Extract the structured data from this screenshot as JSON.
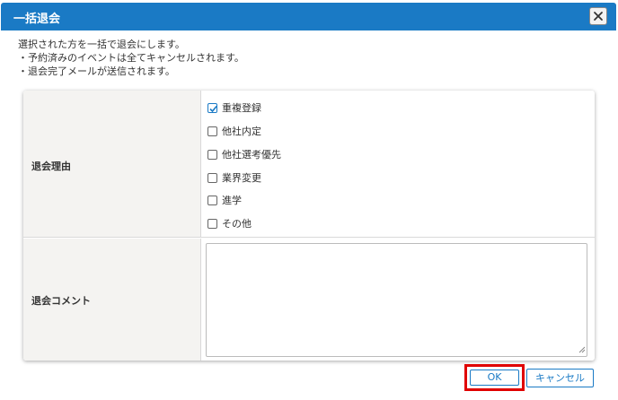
{
  "dialog": {
    "title": "一括退会",
    "close_icon": "close-icon"
  },
  "description": {
    "lines": [
      "選択された方を一括で退会にします。",
      "・予約済みのイベントは全てキャンセルされます。",
      "・退会完了メールが送信されます。"
    ]
  },
  "form": {
    "reason_label": "退会理由",
    "reasons": [
      {
        "label": "重複登録",
        "checked": true
      },
      {
        "label": "他社内定",
        "checked": false
      },
      {
        "label": "他社選考優先",
        "checked": false
      },
      {
        "label": "業界変更",
        "checked": false
      },
      {
        "label": "進学",
        "checked": false
      },
      {
        "label": "その他",
        "checked": false
      }
    ],
    "comment_label": "退会コメント",
    "comment_value": ""
  },
  "buttons": {
    "ok_label": "OK",
    "cancel_label": "キャンセル"
  },
  "colors": {
    "header": "#1a7ac5",
    "highlight": "#e00000"
  }
}
